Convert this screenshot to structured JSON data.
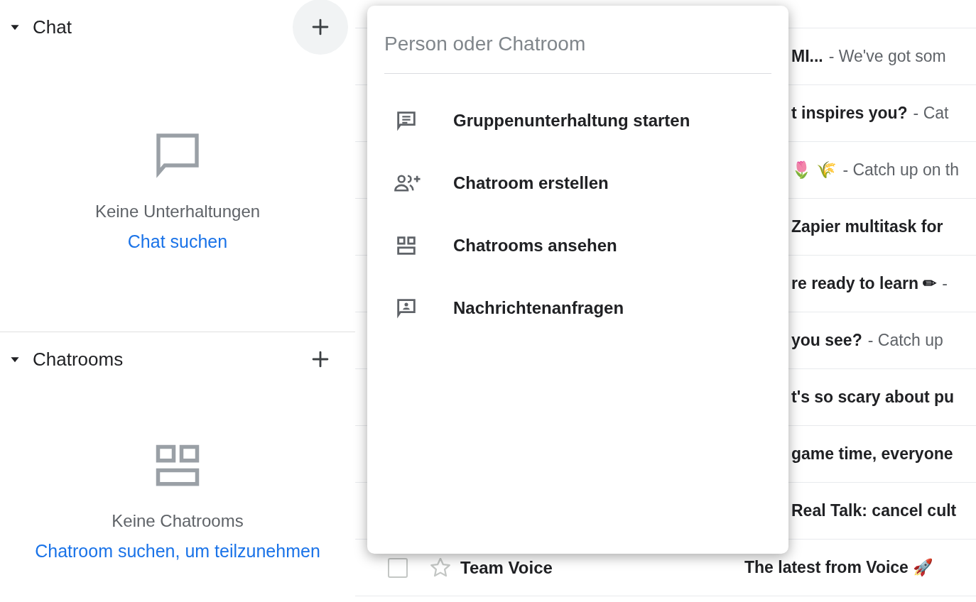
{
  "sections": [
    {
      "title": "Chat",
      "expanded": true,
      "kind": "chat",
      "empty_text": "Keine Unterhaltungen",
      "link": "Chat suchen"
    },
    {
      "title": "Chatrooms",
      "expanded": true,
      "kind": "rooms",
      "empty_text": "Keine Chatrooms",
      "link": "Chatroom suchen, um teilzunehmen"
    }
  ],
  "popup": {
    "placeholder": "Person oder Chatroom",
    "items": [
      {
        "kind": "group",
        "label": "Gruppenunterhaltung starten"
      },
      {
        "kind": "create",
        "label": "Chatroom erstellen"
      },
      {
        "kind": "browse",
        "label": "Chatrooms ansehen"
      },
      {
        "kind": "requests",
        "label": "Nachrichtenanfragen"
      }
    ]
  },
  "emails": [
    {
      "kind": "clipped",
      "subject": "MI...",
      "snippet": "- We've got som"
    },
    {
      "kind": "clipped",
      "subject": "t inspires you?",
      "snippet": "- Cat"
    },
    {
      "kind": "clipped",
      "subject": "🌷 🌾",
      "snippet": "- Catch up on th"
    },
    {
      "kind": "clipped",
      "subject": "Zapier multitask for"
    },
    {
      "kind": "clipped",
      "subject": "re ready to learn ✏",
      "snippet": "-"
    },
    {
      "kind": "clipped",
      "subject": "you see?",
      "snippet": "- Catch up"
    },
    {
      "kind": "clipped",
      "subject": "t's so scary about pu"
    },
    {
      "kind": "clipped",
      "subject": "game time, everyone"
    },
    {
      "kind": "clipped",
      "subject": "Real Talk: cancel cult"
    },
    {
      "kind": "full",
      "checked": false,
      "starred": false,
      "sender": "Team Voice",
      "subject": "The latest from Voice 🚀"
    }
  ]
}
